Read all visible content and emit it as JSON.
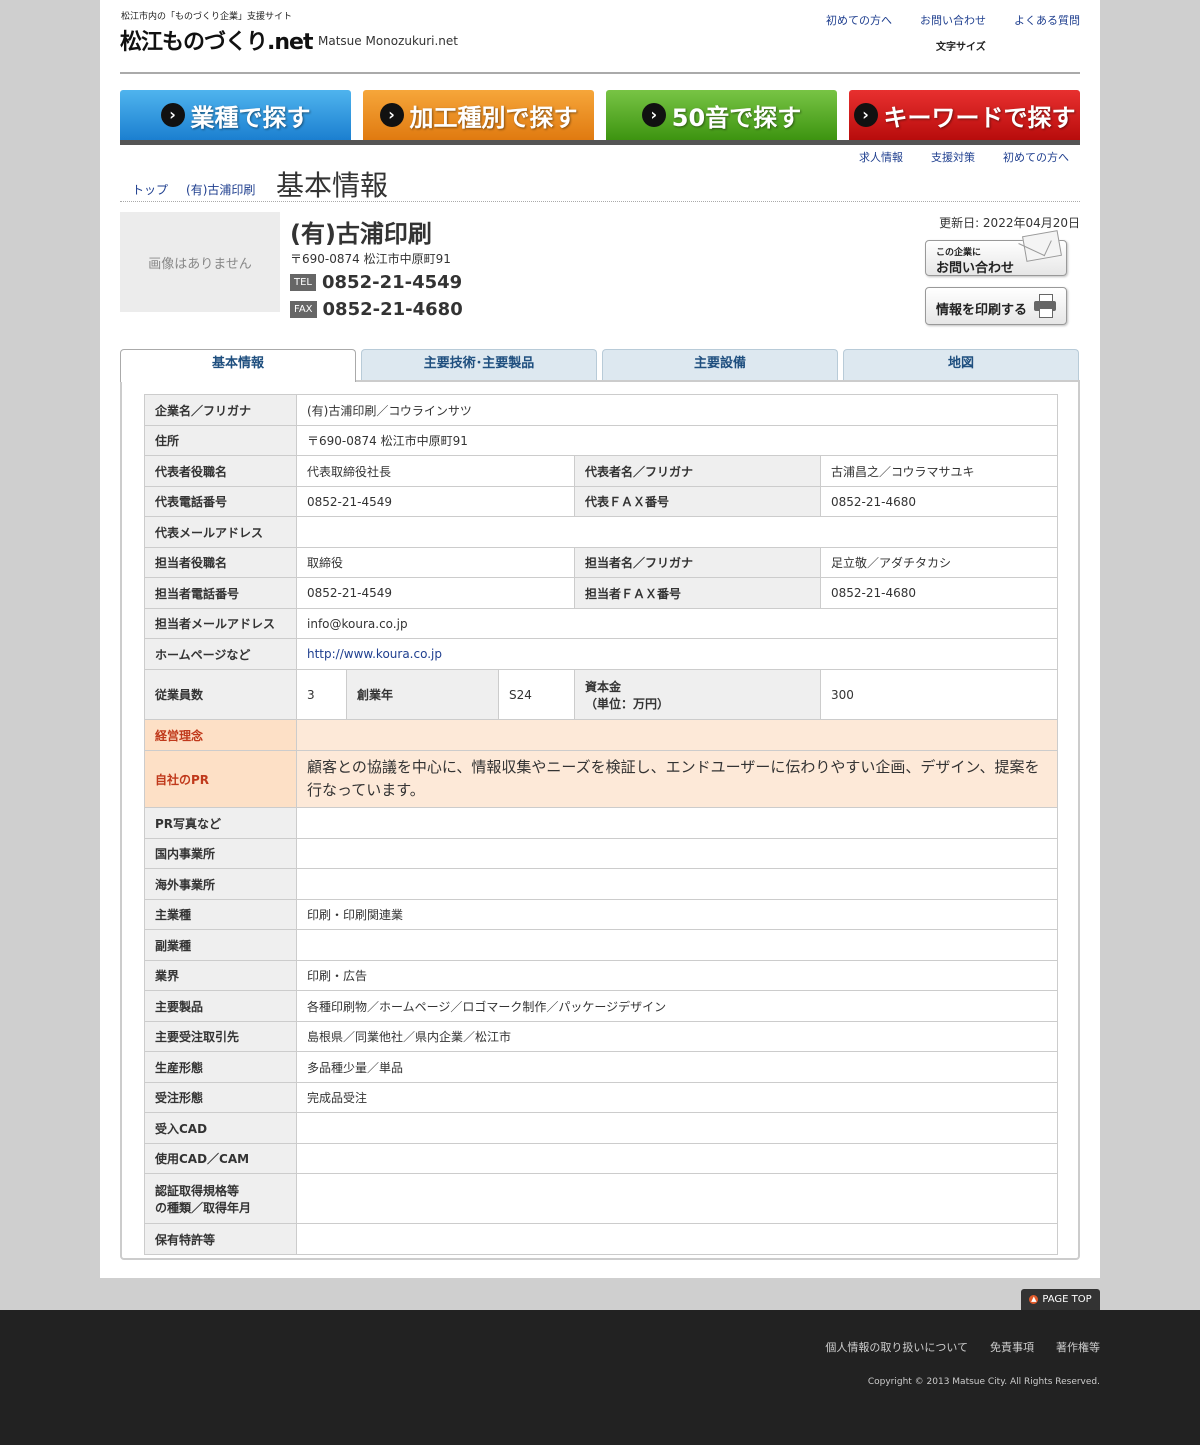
{
  "header": {
    "tagline": "松江市内の「ものづくり企業」支援サイト",
    "logo": "松江ものづくり.net",
    "logo_en": "Matsue Monozukuri.net",
    "top_links": [
      "初めての方へ",
      "お問い合わせ",
      "よくある質問"
    ],
    "font_size_label": "文字サイズ"
  },
  "nav": {
    "buttons": [
      "業種で探す",
      "加工種別で探す",
      "50音で探す",
      "キーワードで探す"
    ],
    "sub_links": [
      "求人情報",
      "支援対策",
      "初めての方へ"
    ]
  },
  "breadcrumb": [
    "トップ",
    "(有)古浦印刷"
  ],
  "page_title": "基本情報",
  "company": {
    "no_image": "画像はありません",
    "name": "(有)古浦印刷",
    "address": "〒690-0874 松江市中原町91",
    "tel_label": "TEL",
    "tel": "0852-21-4549",
    "fax_label": "FAX",
    "fax": "0852-21-4680",
    "updated": "更新日: 2022年04月20日",
    "contact_small": "この企業に",
    "contact_big": "お問い合わせ",
    "print_label": "情報を印刷する"
  },
  "tabs": [
    "基本情報",
    "主要技術･主要製品",
    "主要設備",
    "地図"
  ],
  "table": {
    "r1": {
      "label": "企業名／フリガナ",
      "value": "(有)古浦印刷／コウラインサツ"
    },
    "r2": {
      "label": "住所",
      "value": "〒690-0874 松江市中原町91"
    },
    "r3": {
      "label": "代表者役職名",
      "value": "代表取締役社長",
      "label2": "代表者名／フリガナ",
      "value2": "古浦昌之／コウラマサユキ"
    },
    "r4": {
      "label": "代表電話番号",
      "value": "0852-21-4549",
      "label2": "代表ＦＡＸ番号",
      "value2": "0852-21-4680"
    },
    "r5": {
      "label": "代表メールアドレス",
      "value": ""
    },
    "r6": {
      "label": "担当者役職名",
      "value": "取締役",
      "label2": "担当者名／フリガナ",
      "value2": "足立敬／アダチタカシ"
    },
    "r7": {
      "label": "担当者電話番号",
      "value": "0852-21-4549",
      "label2": "担当者ＦＡＸ番号",
      "value2": "0852-21-4680"
    },
    "r8": {
      "label": "担当者メールアドレス",
      "value": "info@koura.co.jp"
    },
    "r9": {
      "label": "ホームページなど",
      "value": "http://www.koura.co.jp"
    },
    "r10": {
      "label": "従業員数",
      "value": "3",
      "label2": "創業年",
      "value2": "S24",
      "label3a": "資本金",
      "label3b": "（単位：万円）",
      "value3": "300"
    },
    "r11": {
      "label": "経営理念",
      "value": ""
    },
    "r12": {
      "label": "自社のPR",
      "value": "顧客との協議を中心に、情報収集やニーズを検証し、エンドユーザーに伝わりやすい企画、デザイン、提案を行なっています。"
    },
    "r13": {
      "label": "PR写真など",
      "value": ""
    },
    "r14": {
      "label": "国内事業所",
      "value": ""
    },
    "r15": {
      "label": "海外事業所",
      "value": ""
    },
    "r16": {
      "label": "主業種",
      "value": "印刷・印刷関連業"
    },
    "r17": {
      "label": "副業種",
      "value": ""
    },
    "r18": {
      "label": "業界",
      "value": "印刷・広告"
    },
    "r19": {
      "label": "主要製品",
      "value": "各種印刷物／ホームページ／ロゴマーク制作／パッケージデザイン"
    },
    "r20": {
      "label": "主要受注取引先",
      "value": "島根県／同業他社／県内企業／松江市"
    },
    "r21": {
      "label": "生産形態",
      "value": "多品種少量／単品"
    },
    "r22": {
      "label": "受注形態",
      "value": "完成品受注"
    },
    "r23": {
      "label": "受入CAD",
      "value": ""
    },
    "r24": {
      "label": "使用CAD／CAM",
      "value": ""
    },
    "r25": {
      "label_a": "認証取得規格等",
      "label_b": "の種類／取得年月",
      "value": ""
    },
    "r26": {
      "label": "保有特許等",
      "value": ""
    }
  },
  "footer": {
    "page_top": "PAGE TOP",
    "links": [
      "個人情報の取り扱いについて",
      "免責事項",
      "著作権等"
    ],
    "copyright": "Copyright © 2013 Matsue City. All Rights Reserved."
  },
  "colors": {
    "nav_blue": "#1b7fd0",
    "nav_orange": "#e07a10",
    "nav_green": "#3d9410",
    "nav_red": "#b80c0c",
    "highlight_row": "#fde9d8",
    "highlight_label": "#c0391b"
  }
}
